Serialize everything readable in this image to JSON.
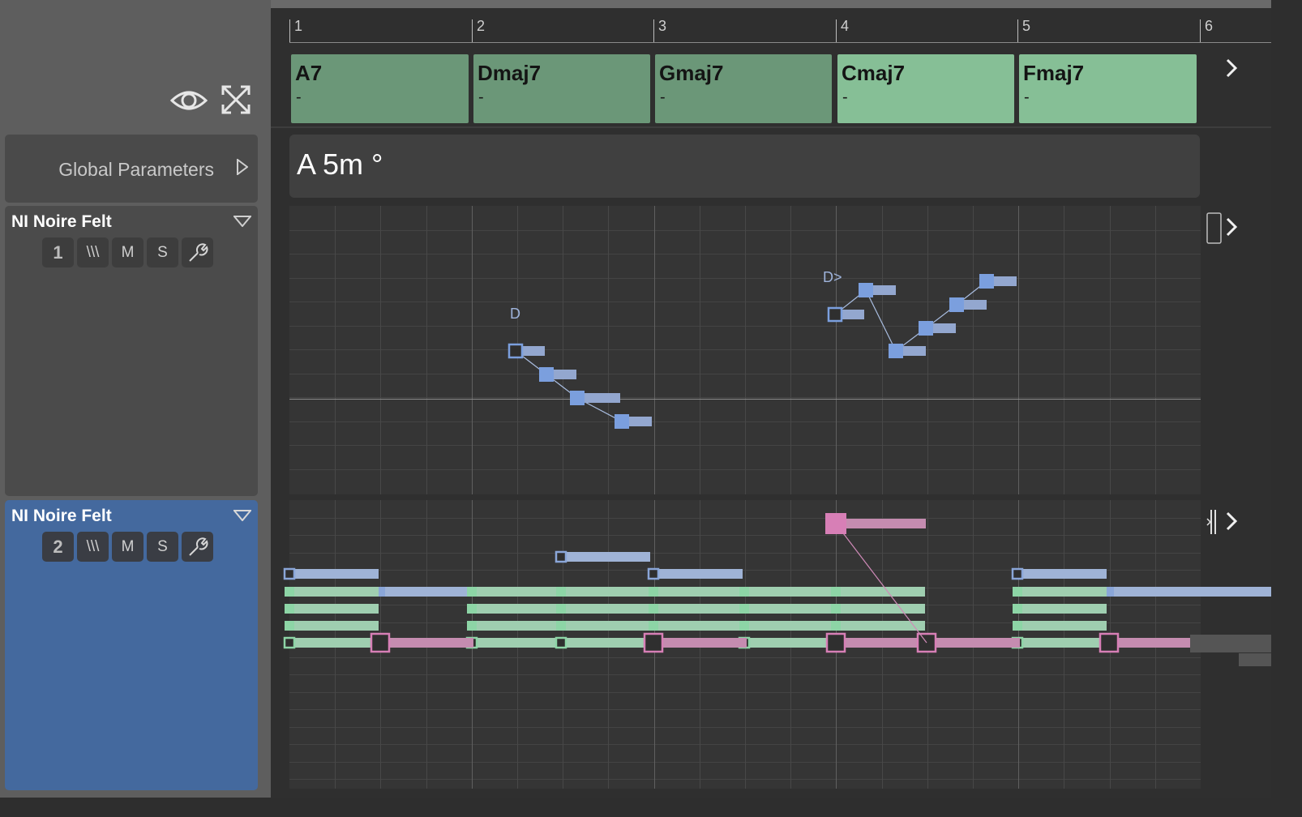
{
  "toolbar": {
    "eye_icon": "eye-icon",
    "fullscreen_icon": "expand-arrows-icon"
  },
  "global_parameters": {
    "label": "Global Parameters"
  },
  "tracks": [
    {
      "name": "NI Noire Felt",
      "number": "1",
      "lanes_label": "\\\\\\",
      "mute_label": "M",
      "solo_label": "S",
      "settings_icon": "wrench-icon",
      "selected": false
    },
    {
      "name": "NI Noire Felt",
      "number": "2",
      "lanes_label": "\\\\\\",
      "mute_label": "M",
      "solo_label": "S",
      "settings_icon": "wrench-icon",
      "selected": true
    }
  ],
  "ruler": {
    "bars": [
      "1",
      "2",
      "3",
      "4",
      "5",
      "6"
    ]
  },
  "chords": [
    {
      "name": "A7",
      "sub": "-",
      "color": "#6b9778"
    },
    {
      "name": "Dmaj7",
      "sub": "-",
      "color": "#6b9778"
    },
    {
      "name": "Gmaj7",
      "sub": "-",
      "color": "#6b9778"
    },
    {
      "name": "Cmaj7",
      "sub": "-",
      "color": "#86bf96"
    },
    {
      "name": "Fmaj7",
      "sub": "-",
      "color": "#86bf96"
    }
  ],
  "key": {
    "label": "A 5m °"
  },
  "phrase_markers": {
    "first": "D",
    "second": "D>"
  },
  "colors": {
    "melody": "#7b9fde",
    "chord_tone": "#8dd5a6",
    "bass": "#d77fb6",
    "selected_track": "#44699e"
  }
}
